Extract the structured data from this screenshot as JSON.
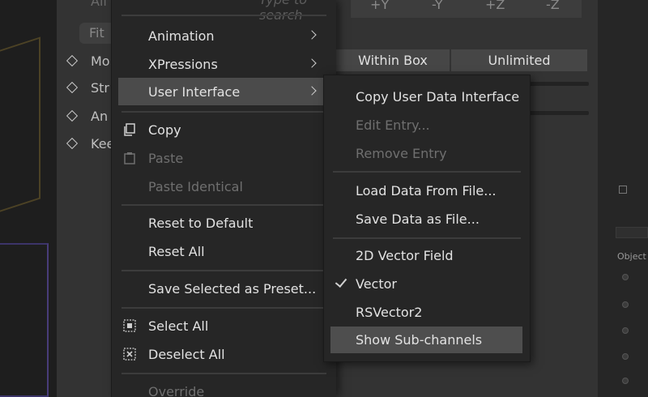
{
  "background": {
    "search_placeholder": "Type to search",
    "faint_top_label": "Ali",
    "fit_label": "Fit",
    "property_labels": [
      "Mo",
      "Str",
      "An",
      "Kee"
    ],
    "axis_buttons": [
      "+Y",
      "-Y",
      "+Z",
      "-Z"
    ],
    "within_box_label": "Within Box",
    "unlimited_label": "Unlimited",
    "right_panel_label": "Object"
  },
  "menu": {
    "items": [
      {
        "label": "Animation",
        "submenu": true
      },
      {
        "label": "XPressions",
        "submenu": true
      },
      {
        "label": "User Interface",
        "submenu": true,
        "active": true
      },
      {
        "label": "Copy",
        "icon": "copy-icon"
      },
      {
        "label": "Paste",
        "icon": "paste-icon",
        "disabled": true
      },
      {
        "label": "Paste Identical",
        "disabled": true
      },
      {
        "label": "Reset to Default"
      },
      {
        "label": "Reset All"
      },
      {
        "label": "Save Selected as Preset..."
      },
      {
        "label": "Select All",
        "icon": "select-all-icon"
      },
      {
        "label": "Deselect All",
        "icon": "deselect-all-icon"
      },
      {
        "label": "Override",
        "disabled": true
      }
    ]
  },
  "submenu": {
    "items": [
      {
        "label": "Copy User Data Interface"
      },
      {
        "label": "Edit Entry...",
        "disabled": true
      },
      {
        "label": "Remove Entry",
        "disabled": true
      },
      {
        "label": "Load Data From File..."
      },
      {
        "label": "Save Data as File..."
      },
      {
        "label": "2D Vector Field"
      },
      {
        "label": "Vector",
        "checked": true
      },
      {
        "label": "RSVector2"
      },
      {
        "label": "Show Sub-channels",
        "active": true
      }
    ]
  }
}
